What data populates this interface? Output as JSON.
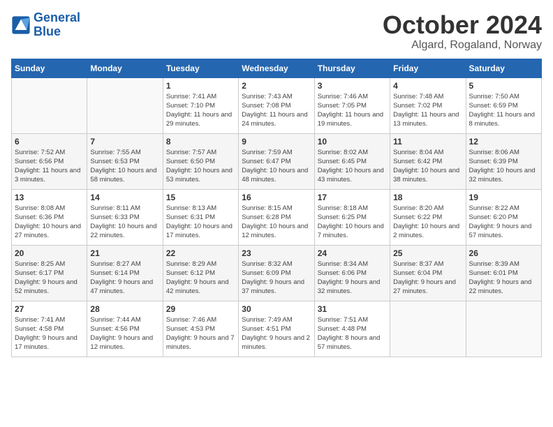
{
  "logo": {
    "text_general": "General",
    "text_blue": "Blue"
  },
  "header": {
    "month": "October 2024",
    "location": "Algard, Rogaland, Norway"
  },
  "weekdays": [
    "Sunday",
    "Monday",
    "Tuesday",
    "Wednesday",
    "Thursday",
    "Friday",
    "Saturday"
  ],
  "weeks": [
    [
      {
        "day": "",
        "info": ""
      },
      {
        "day": "",
        "info": ""
      },
      {
        "day": "1",
        "info": "Sunrise: 7:41 AM\nSunset: 7:10 PM\nDaylight: 11 hours and 29 minutes."
      },
      {
        "day": "2",
        "info": "Sunrise: 7:43 AM\nSunset: 7:08 PM\nDaylight: 11 hours and 24 minutes."
      },
      {
        "day": "3",
        "info": "Sunrise: 7:46 AM\nSunset: 7:05 PM\nDaylight: 11 hours and 19 minutes."
      },
      {
        "day": "4",
        "info": "Sunrise: 7:48 AM\nSunset: 7:02 PM\nDaylight: 11 hours and 13 minutes."
      },
      {
        "day": "5",
        "info": "Sunrise: 7:50 AM\nSunset: 6:59 PM\nDaylight: 11 hours and 8 minutes."
      }
    ],
    [
      {
        "day": "6",
        "info": "Sunrise: 7:52 AM\nSunset: 6:56 PM\nDaylight: 11 hours and 3 minutes."
      },
      {
        "day": "7",
        "info": "Sunrise: 7:55 AM\nSunset: 6:53 PM\nDaylight: 10 hours and 58 minutes."
      },
      {
        "day": "8",
        "info": "Sunrise: 7:57 AM\nSunset: 6:50 PM\nDaylight: 10 hours and 53 minutes."
      },
      {
        "day": "9",
        "info": "Sunrise: 7:59 AM\nSunset: 6:47 PM\nDaylight: 10 hours and 48 minutes."
      },
      {
        "day": "10",
        "info": "Sunrise: 8:02 AM\nSunset: 6:45 PM\nDaylight: 10 hours and 43 minutes."
      },
      {
        "day": "11",
        "info": "Sunrise: 8:04 AM\nSunset: 6:42 PM\nDaylight: 10 hours and 38 minutes."
      },
      {
        "day": "12",
        "info": "Sunrise: 8:06 AM\nSunset: 6:39 PM\nDaylight: 10 hours and 32 minutes."
      }
    ],
    [
      {
        "day": "13",
        "info": "Sunrise: 8:08 AM\nSunset: 6:36 PM\nDaylight: 10 hours and 27 minutes."
      },
      {
        "day": "14",
        "info": "Sunrise: 8:11 AM\nSunset: 6:33 PM\nDaylight: 10 hours and 22 minutes."
      },
      {
        "day": "15",
        "info": "Sunrise: 8:13 AM\nSunset: 6:31 PM\nDaylight: 10 hours and 17 minutes."
      },
      {
        "day": "16",
        "info": "Sunrise: 8:15 AM\nSunset: 6:28 PM\nDaylight: 10 hours and 12 minutes."
      },
      {
        "day": "17",
        "info": "Sunrise: 8:18 AM\nSunset: 6:25 PM\nDaylight: 10 hours and 7 minutes."
      },
      {
        "day": "18",
        "info": "Sunrise: 8:20 AM\nSunset: 6:22 PM\nDaylight: 10 hours and 2 minutes."
      },
      {
        "day": "19",
        "info": "Sunrise: 8:22 AM\nSunset: 6:20 PM\nDaylight: 9 hours and 57 minutes."
      }
    ],
    [
      {
        "day": "20",
        "info": "Sunrise: 8:25 AM\nSunset: 6:17 PM\nDaylight: 9 hours and 52 minutes."
      },
      {
        "day": "21",
        "info": "Sunrise: 8:27 AM\nSunset: 6:14 PM\nDaylight: 9 hours and 47 minutes."
      },
      {
        "day": "22",
        "info": "Sunrise: 8:29 AM\nSunset: 6:12 PM\nDaylight: 9 hours and 42 minutes."
      },
      {
        "day": "23",
        "info": "Sunrise: 8:32 AM\nSunset: 6:09 PM\nDaylight: 9 hours and 37 minutes."
      },
      {
        "day": "24",
        "info": "Sunrise: 8:34 AM\nSunset: 6:06 PM\nDaylight: 9 hours and 32 minutes."
      },
      {
        "day": "25",
        "info": "Sunrise: 8:37 AM\nSunset: 6:04 PM\nDaylight: 9 hours and 27 minutes."
      },
      {
        "day": "26",
        "info": "Sunrise: 8:39 AM\nSunset: 6:01 PM\nDaylight: 9 hours and 22 minutes."
      }
    ],
    [
      {
        "day": "27",
        "info": "Sunrise: 7:41 AM\nSunset: 4:58 PM\nDaylight: 9 hours and 17 minutes."
      },
      {
        "day": "28",
        "info": "Sunrise: 7:44 AM\nSunset: 4:56 PM\nDaylight: 9 hours and 12 minutes."
      },
      {
        "day": "29",
        "info": "Sunrise: 7:46 AM\nSunset: 4:53 PM\nDaylight: 9 hours and 7 minutes."
      },
      {
        "day": "30",
        "info": "Sunrise: 7:49 AM\nSunset: 4:51 PM\nDaylight: 9 hours and 2 minutes."
      },
      {
        "day": "31",
        "info": "Sunrise: 7:51 AM\nSunset: 4:48 PM\nDaylight: 8 hours and 57 minutes."
      },
      {
        "day": "",
        "info": ""
      },
      {
        "day": "",
        "info": ""
      }
    ]
  ]
}
